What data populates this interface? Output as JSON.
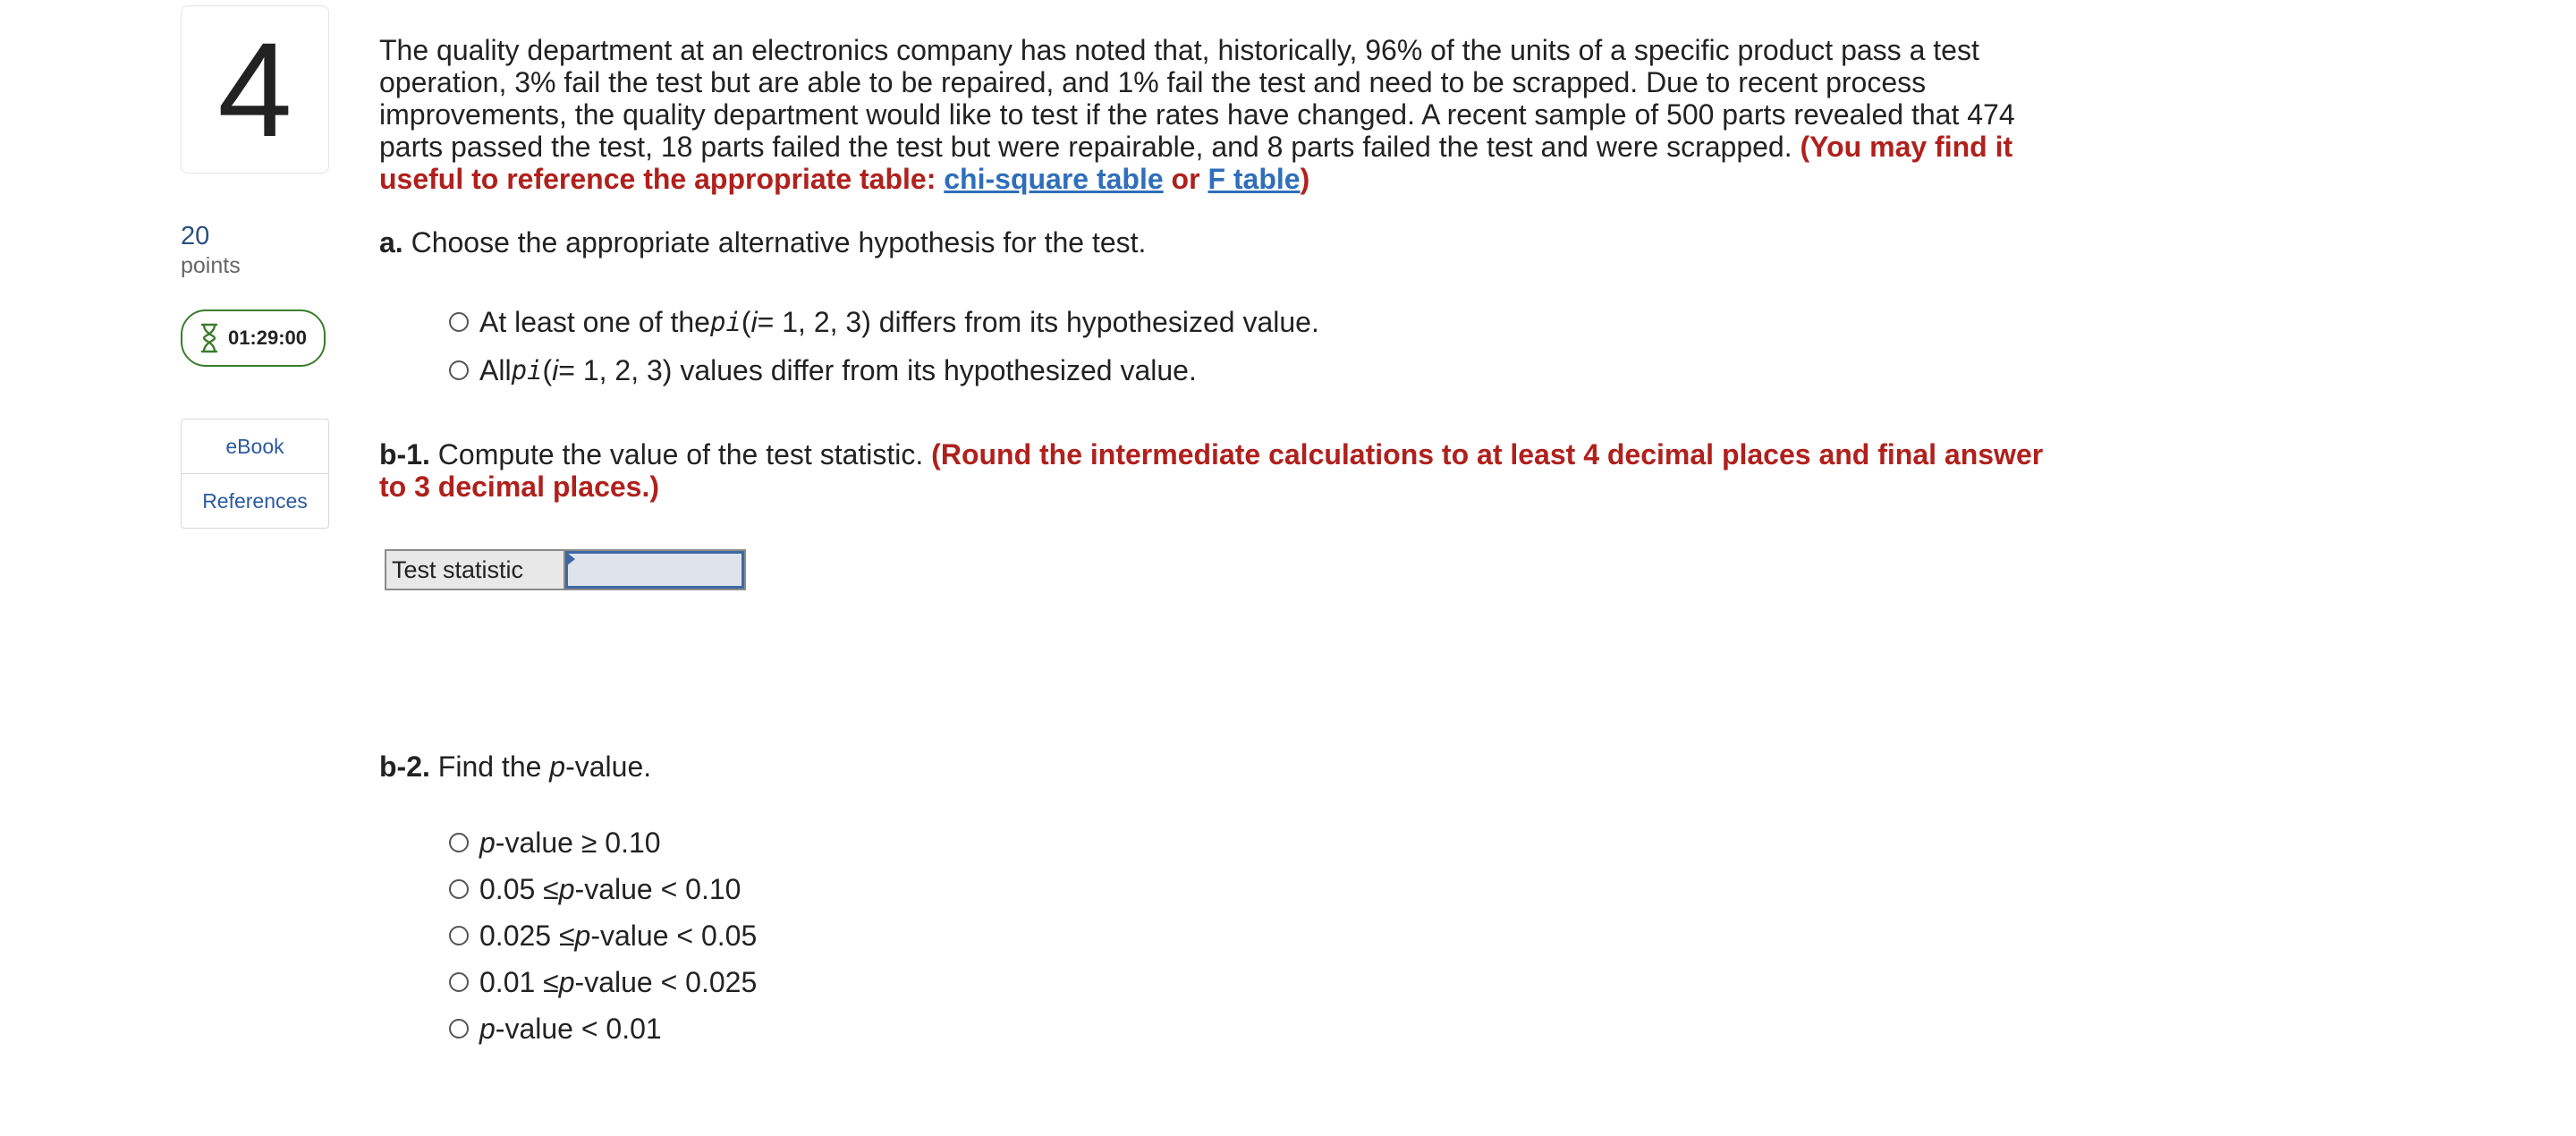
{
  "question": {
    "number": "4",
    "points_value": "20",
    "points_label": "points",
    "timer": "01:29:00",
    "tools": [
      "eBook",
      "References"
    ],
    "stem": "The quality department at an electronics company has noted that, historically, 96% of the units of a specific product pass a test operation, 3% fail the test but are able to be repaired, and 1% fail the test and need to be scrapped. Due to recent process improvements, the quality department would like to test if the rates have changed. A recent sample of 500 parts revealed that 474 parts passed the test, 18 parts failed the test but were repairable, and 8 parts failed the test and were scrapped.",
    "hint_prefix": "(You may find it useful to reference the appropriate table: ",
    "link_chi": "chi-square table",
    "hint_or": " or ",
    "link_f": "F table",
    "hint_suffix": ")"
  },
  "part_a": {
    "label": "a.",
    "prompt": "Choose the appropriate alternative hypothesis for the test.",
    "options": [
      {
        "pre": "At least one of the ",
        "sym": "p",
        "sub": "i",
        "mid": " (",
        "var": "i",
        "post": " = 1, 2, 3) differs from its hypothesized value."
      },
      {
        "pre": "All ",
        "sym": "p",
        "sub": "i",
        "mid": " (",
        "var": "i",
        "post": " = 1, 2, 3) values differ from its hypothesized value."
      }
    ]
  },
  "part_b1": {
    "label": "b-1.",
    "prompt": "Compute the value of the test statistic.",
    "instruction": "(Round the intermediate calculations to at least 4 decimal places and final answer to 3 decimal places.)",
    "field_label": "Test statistic",
    "field_value": ""
  },
  "part_b2": {
    "label": "b-2.",
    "prompt_pre": "Find the ",
    "prompt_var": "p",
    "prompt_post": "-value.",
    "options": [
      {
        "left": "",
        "var": "p",
        "right": "-value ≥ 0.10"
      },
      {
        "left": "0.05 ≤ ",
        "var": "p",
        "right": "-value < 0.10"
      },
      {
        "left": "0.025 ≤ ",
        "var": "p",
        "right": "-value < 0.05"
      },
      {
        "left": "0.01 ≤ ",
        "var": "p",
        "right": "-value < 0.025"
      },
      {
        "left": "",
        "var": "p",
        "right": "-value < 0.01"
      }
    ]
  },
  "colors": {
    "accent_red": "#b0201c",
    "link_blue": "#2f6eba",
    "timer_green": "#3a7d2c"
  }
}
